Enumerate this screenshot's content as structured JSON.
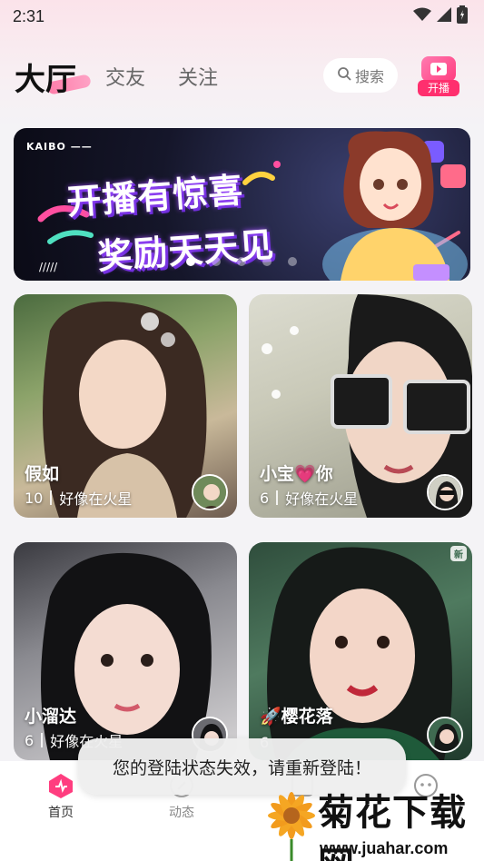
{
  "status_bar": {
    "time": "2:31"
  },
  "header": {
    "tabs": [
      {
        "label": "大厅",
        "active": true
      },
      {
        "label": "交友",
        "active": false
      },
      {
        "label": "关注",
        "active": false
      }
    ],
    "search_label": "搜索",
    "live_button_label": "开播"
  },
  "banner": {
    "brand": "KAIBO ——",
    "title_line1": "开播有惊喜",
    "title_line2": "奖励天天见",
    "stripes": "/////",
    "slides": 5,
    "active_slide": 0
  },
  "cards": [
    {
      "name": "假如",
      "count": "10",
      "location": "好像在火星",
      "is_new": false
    },
    {
      "name": "小宝💗你",
      "count": "6",
      "location": "好像在火星",
      "is_new": false
    },
    {
      "name": "小溜达",
      "count": "6",
      "location": "好像在火星",
      "is_new": false
    },
    {
      "name": "🚀樱花落",
      "count": "6",
      "location": "",
      "is_new": true,
      "badge": "新"
    }
  ],
  "bottom_nav": [
    {
      "label": "首页",
      "active": true
    },
    {
      "label": "动态",
      "active": false
    },
    {
      "label": "",
      "active": false
    },
    {
      "label": "",
      "active": false
    }
  ],
  "toast": {
    "message": "您的登陆状态失效，请重新登陆！"
  },
  "watermark": {
    "title": "菊花下载网",
    "url": "www.juahar.com"
  },
  "colors": {
    "accent": "#ff3d7f",
    "background": "#f4f3f6"
  },
  "icons": [
    "wifi-icon",
    "signal-icon",
    "battery-icon",
    "search-icon",
    "live-icon",
    "home-icon",
    "feed-icon",
    "message-icon",
    "profile-icon"
  ]
}
